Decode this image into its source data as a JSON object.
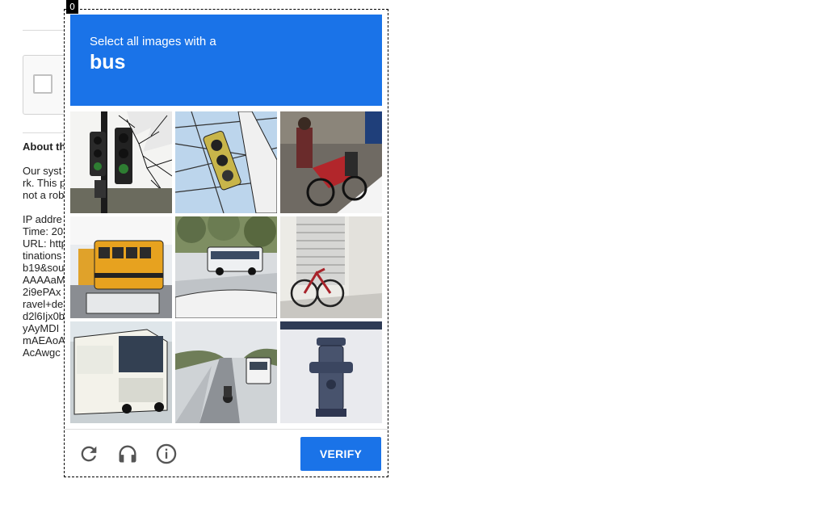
{
  "page": {
    "section_heading": "About th",
    "text_lines": [
      "Our syst",
      "rk. This p",
      "not a rob",
      "IP addre",
      "Time: 20",
      "URL: http",
      "tinations",
      "b19&sou",
      "AAAAaM",
      "2i9ePAx",
      "ravel+de",
      "d2l6Ijx0b",
      "yAyMDI",
      "mAEAoA",
      "AcAwgc"
    ]
  },
  "challenge": {
    "tag": "0",
    "instruction": "Select all images with a",
    "target": "bus",
    "tiles": [
      {
        "label": "traffic-light-tree"
      },
      {
        "label": "traffic-light-wires"
      },
      {
        "label": "motorcycle-street"
      },
      {
        "label": "school-bus"
      },
      {
        "label": "bus-on-road"
      },
      {
        "label": "bicycle-shutter"
      },
      {
        "label": "bus-front"
      },
      {
        "label": "road-with-bus"
      },
      {
        "label": "fire-hydrant"
      }
    ],
    "verify_label": "VERIFY",
    "colors": {
      "accent": "#1a73e8",
      "icon": "#555555"
    }
  }
}
